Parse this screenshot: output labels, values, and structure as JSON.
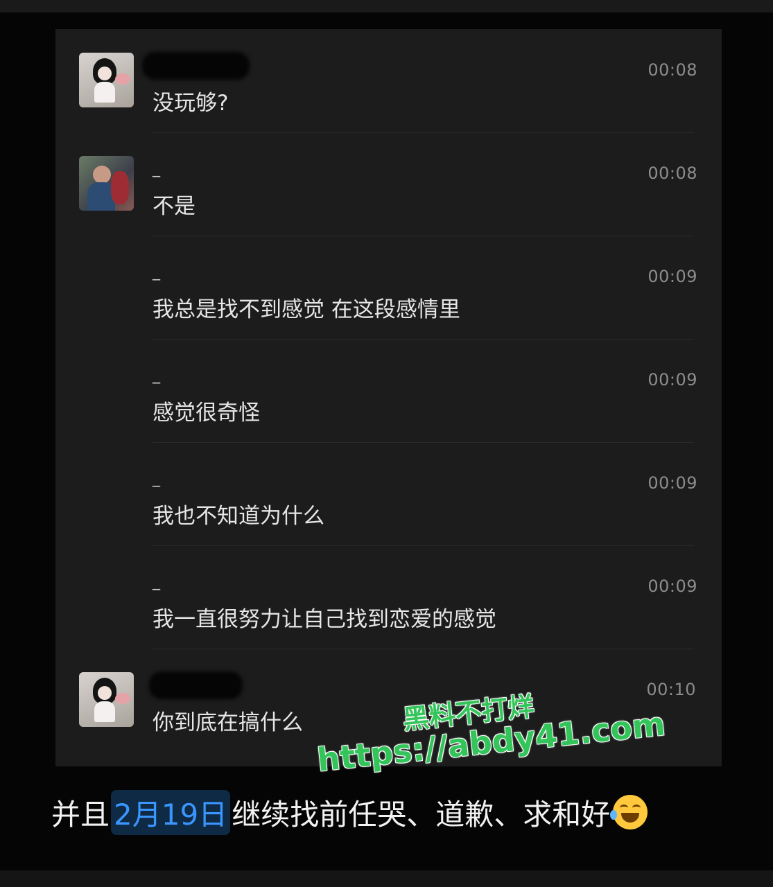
{
  "chat": {
    "messages": [
      {
        "avatar": "girl-avatar",
        "nickname": "",
        "time": "00:08",
        "text": "没玩够?"
      },
      {
        "avatar": "photo-avatar",
        "nickname": "_",
        "time": "00:08",
        "text": "不是"
      },
      {
        "avatar": "",
        "nickname": "_",
        "time": "00:09",
        "text": "我总是找不到感觉 在这段感情里"
      },
      {
        "avatar": "",
        "nickname": "_",
        "time": "00:09",
        "text": "感觉很奇怪"
      },
      {
        "avatar": "",
        "nickname": "_",
        "time": "00:09",
        "text": "我也不知道为什么"
      },
      {
        "avatar": "",
        "nickname": "_",
        "time": "00:09",
        "text": "我一直很努力让自己找到恋爱的感觉"
      },
      {
        "avatar": "girl-avatar",
        "nickname": "",
        "time": "00:10",
        "text": "你到底在搞什么"
      }
    ]
  },
  "watermark": {
    "line1": "黑料不打烊",
    "line2": "https://abdy41.com"
  },
  "caption": {
    "before": "并且",
    "date": "2月19日",
    "after": "继续找前任哭、道歉、求和好",
    "emoji": "rolling-on-floor-laughing-emoji"
  }
}
